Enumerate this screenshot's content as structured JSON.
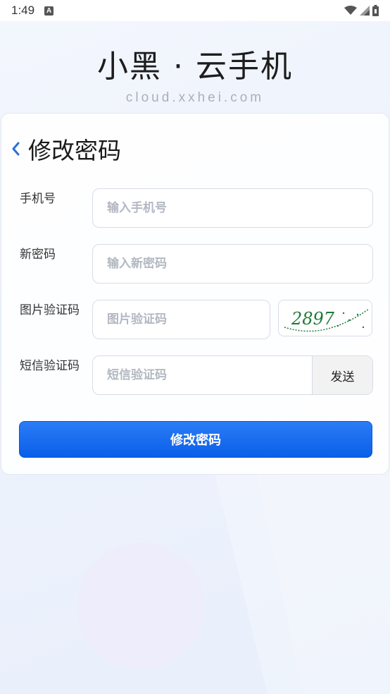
{
  "status_bar": {
    "time": "1:49",
    "notif_icon_letter": "A"
  },
  "brand": {
    "title": "小黑 · 云手机",
    "subtitle": "cloud.xxhei.com"
  },
  "form": {
    "title": "修改密码",
    "phone": {
      "label": "手机号",
      "placeholder": "输入手机号",
      "value": ""
    },
    "new_password": {
      "label": "新密码",
      "placeholder": "输入新密码",
      "value": ""
    },
    "image_code": {
      "label": "图片验证码",
      "placeholder": "图片验证码",
      "value": "",
      "captcha_text": "2897"
    },
    "sms_code": {
      "label": "短信验证码",
      "placeholder": "短信验证码",
      "value": "",
      "send_label": "发送"
    },
    "submit_label": "修改密码"
  },
  "colors": {
    "accent": "#0a5fe8",
    "back_icon": "#2b6fd6",
    "captcha_ink": "#1f7a3a"
  },
  "icons": {
    "back": "chevron-left-icon",
    "wifi": "wifi-icon",
    "signal": "cell-signal-icon",
    "battery": "battery-icon"
  }
}
